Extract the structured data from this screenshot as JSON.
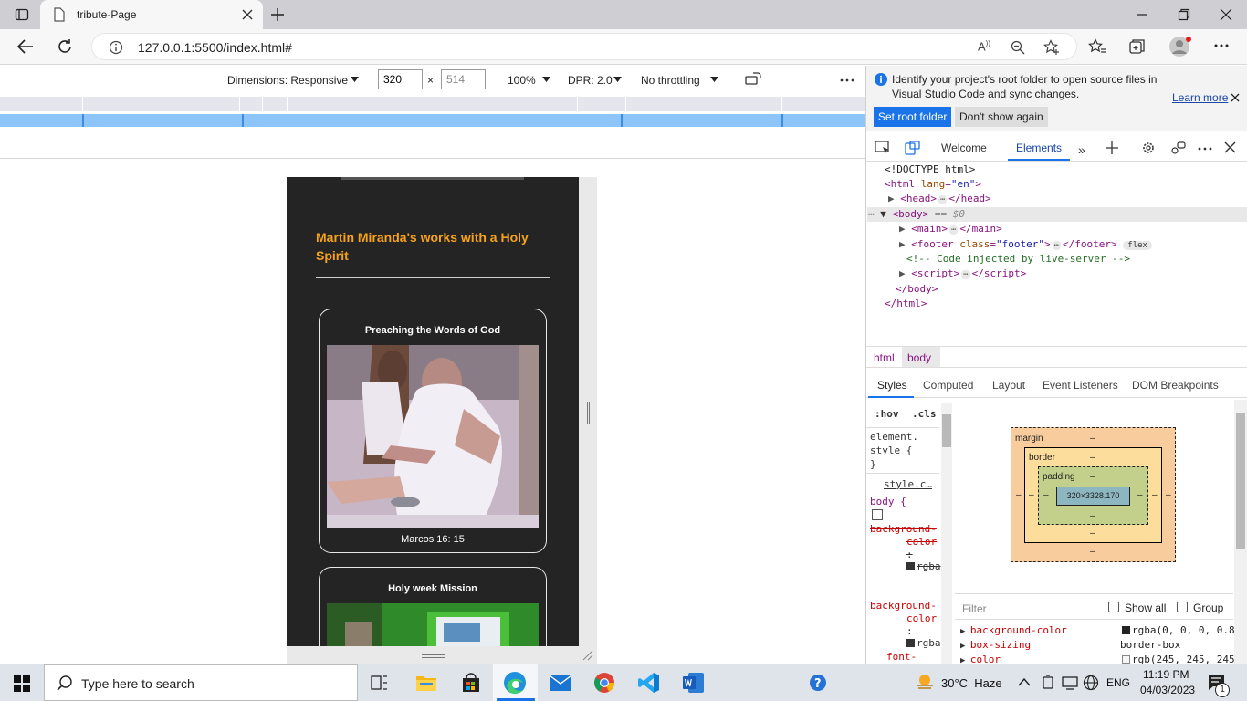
{
  "browser": {
    "tab_title": "tribute-Page",
    "url": "127.0.0.1:5500/index.html#"
  },
  "device_toolbar": {
    "dimensions_label": "Dimensions: Responsive",
    "width_value": "320",
    "height_value": "514",
    "times": "×",
    "zoom": "100%",
    "dpr": "DPR: 2.0",
    "throttling": "No throttling"
  },
  "page": {
    "heading": "Martin Miranda's works with a Holy Spirit",
    "cards": [
      {
        "title": "Preaching the Words of God",
        "caption": "Marcos 16: 15"
      },
      {
        "title": "Holy week Mission"
      }
    ]
  },
  "devtools": {
    "infobar_text": "Identify your project's root folder to open source files in Visual Studio Code and sync changes.",
    "learn_more": "Learn more",
    "set_root_button": "Set root folder",
    "dont_show_button": "Don't show again",
    "tabs": [
      "Welcome",
      "Elements"
    ],
    "dom_doctype": "<!DOCTYPE html>",
    "dom_html_open_tag": "html",
    "dom_html_attr": "lang",
    "dom_html_attr_val": "\"en\"",
    "dom_head": "head",
    "dom_body": "body",
    "dom_body_marker": " == $0",
    "dom_main": "main",
    "dom_footer": "footer",
    "dom_footer_attr": "class",
    "dom_footer_val": "\"footer\"",
    "dom_footer_badge": "flex",
    "dom_comment": "<!-- Code injected by live-server -->",
    "dom_script": "script",
    "dom_body_close": "</body>",
    "dom_html_close": "</html>",
    "breadcrumbs": [
      "html",
      "body"
    ],
    "style_tabs": [
      "Styles",
      "Computed",
      "Layout",
      "Event Listeners",
      "DOM Breakpoints"
    ],
    "hov": ":hov",
    "cls": ".cls",
    "element_style": "element.",
    "element_style2": "style {",
    "close_brace": "}",
    "style_link": "style.c…",
    "body_rule": "body {",
    "prop1a": "background-",
    "prop1b": "color",
    "prop1c": ":",
    "prop1d": "rgba",
    "box_margin": "margin",
    "box_border": "border",
    "box_padding": "padding",
    "box_content": "320×3328.170",
    "dash": "–",
    "filter_placeholder": "Filter",
    "show_all": "Show all",
    "group": "Group",
    "computed": [
      {
        "prop": "background-color",
        "val": "rgba(0, 0, 0, 0.8"
      },
      {
        "prop": "box-sizing",
        "val": "border-box"
      },
      {
        "prop": "color",
        "val": "rgb(245, 245, 245"
      }
    ],
    "font_prop": "font-"
  },
  "taskbar": {
    "search_placeholder": "Type here to search",
    "weather": "30°C  Haze",
    "lang": "ENG",
    "time": "11:19 PM",
    "date": "04/03/2023",
    "notif_count": "1"
  }
}
